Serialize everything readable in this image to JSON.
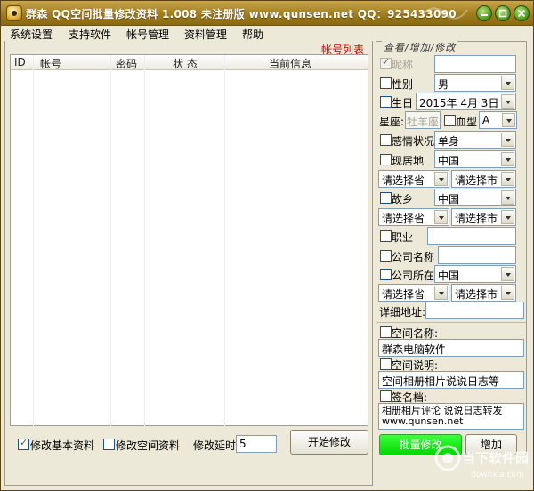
{
  "window": {
    "title": "群森 QQ空间批量修改资料 1.008  未注册版  www.qunsen.net  QQ：925433090"
  },
  "menu": [
    "系统设置",
    "支持软件",
    "帐号管理",
    "资料管理",
    "帮助"
  ],
  "account_list": {
    "title": "帐号列表",
    "columns": [
      "ID",
      "帐号",
      "密码",
      "状 态",
      "当前信息"
    ]
  },
  "bottom": {
    "modify_basic": "修改基本资料",
    "modify_space": "修改空间资料",
    "delay_label": "修改延时",
    "delay_value": "5",
    "start_button": "开始修改"
  },
  "form": {
    "group_title": "查看/增加/修改",
    "nickname_label": "昵称",
    "gender_label": "性别",
    "gender_value": "男",
    "birthday_label": "生日",
    "birthday_value": "2015年 4月 3日",
    "zodiac_label": "星座:",
    "zodiac_value": "牡羊座",
    "blood_label": "血型",
    "blood_value": "A",
    "marital_label": "感情状况",
    "marital_value": "单身",
    "residence_label": "现居地",
    "residence_value": "中国",
    "province_placeholder": "请选择省",
    "city_placeholder": "请选择市",
    "hometown_label": "故乡",
    "hometown_value": "中国",
    "job_label": "职业",
    "company_label": "公司名称",
    "company_loc_label": "公司所在",
    "company_loc_value": "中国",
    "address_label": "详细地址:",
    "space_name_label": "空间名称:",
    "space_name_value": "群森电脑软件",
    "space_desc_label": "空间说明:",
    "space_desc_value": "空间相册相片说说日志等",
    "signature_label": "签名档:",
    "signature_value": "相册相片评论 说说日志转发 www.qunsen.net",
    "batch_button": "批量修改",
    "add_button": "增加"
  },
  "watermark": {
    "name": "当下软件园",
    "url": "downxia.com"
  },
  "colors": {
    "title_bar": "#a07d1e",
    "window_bg": "#ece9d8",
    "list_title": "#e00000",
    "batch_button": "#00e000"
  }
}
